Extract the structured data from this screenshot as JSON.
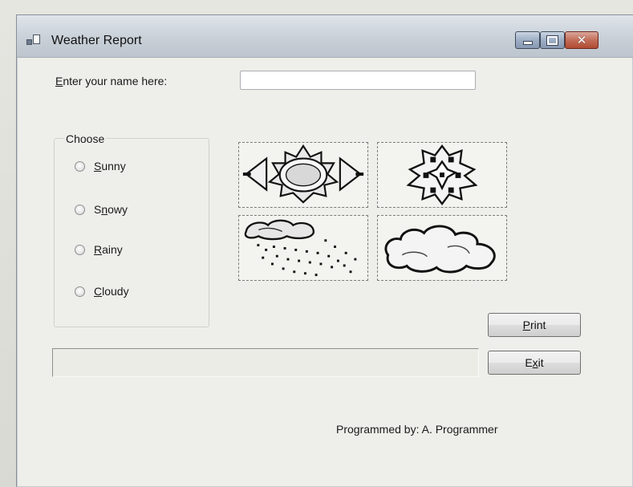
{
  "window": {
    "title": "Weather Report",
    "controls": {
      "minimize": "–",
      "maximize": "□",
      "close": "✕"
    }
  },
  "name_prompt": {
    "label_accel": "E",
    "label_rest": "nter your name here:",
    "value": "",
    "placeholder": ""
  },
  "group": {
    "title": "Choose",
    "options": [
      {
        "accel": "S",
        "rest": "unny",
        "checked": false
      },
      {
        "accel": "n",
        "pre": "S",
        "rest": "owy",
        "checked": false
      },
      {
        "accel": "R",
        "rest": "ainy",
        "checked": false
      },
      {
        "accel": "C",
        "rest": "loudy",
        "checked": false
      }
    ]
  },
  "pictures": [
    "sun-icon",
    "snowflake-icon",
    "rain-cloud-icon",
    "cloud-icon"
  ],
  "status": {
    "text": ""
  },
  "buttons": {
    "print": {
      "accel": "P",
      "rest": "rint"
    },
    "exit": {
      "pre": "E",
      "accel": "x",
      "rest": "it"
    }
  },
  "credit": "Programmed by: A. Programmer",
  "colors": {
    "window_bg": "#eeeeea",
    "titlebar": "#c9d0d8",
    "close_button": "#c26d58"
  }
}
